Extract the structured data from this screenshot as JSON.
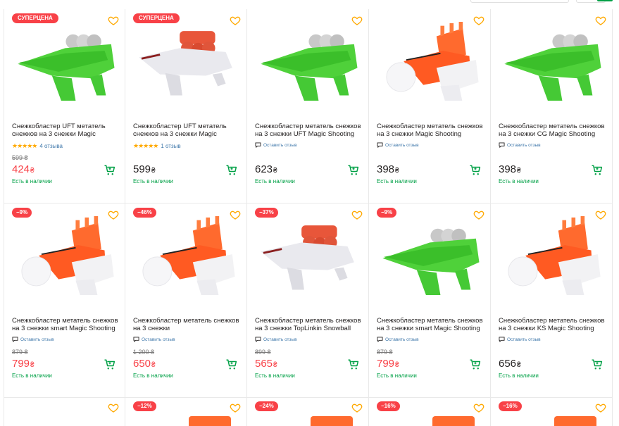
{
  "colors": {
    "accent_green": "#00a046",
    "sale_red": "#f84147",
    "link_blue": "#3e77aa",
    "star": "#ffa900"
  },
  "products": [
    {
      "badge": "СУПЕРЦЕНА",
      "title": "Снежкобластер UFT метатель снежков на 3 снежки Magic",
      "rating_stars": "★★★★★",
      "rating_text": "4 отзыва",
      "review_link": "",
      "old_price": "599 ₴",
      "price": "424",
      "currency": "₴",
      "price_sale": true,
      "stock": "Есть в наличии",
      "image": "green-blaster"
    },
    {
      "badge": "СУПЕРЦЕНА",
      "title": "Снежкобластер UFT метатель снежков на 3 снежки Magic",
      "rating_stars": "★★★★★",
      "rating_text": "1 отзыв",
      "review_link": "",
      "old_price": "",
      "price": "599",
      "currency": "₴",
      "price_sale": false,
      "stock": "Есть в наличии",
      "image": "white-blaster"
    },
    {
      "badge": "",
      "title": "Снежкобластер метатель снежков на 3 снежки UFT Magic Shooting",
      "rating_stars": "",
      "rating_text": "",
      "review_link": "Оставить отзыв",
      "old_price": "",
      "price": "623",
      "currency": "₴",
      "price_sale": false,
      "stock": "Есть в наличии",
      "image": "green-blaster"
    },
    {
      "badge": "",
      "title": "Снежкобластер метатель снежков на 3 снежки Magic Shooting",
      "rating_stars": "",
      "rating_text": "",
      "review_link": "Оставить отзыв",
      "old_price": "",
      "price": "398",
      "currency": "₴",
      "price_sale": false,
      "stock": "Есть в наличии",
      "image": "orange-blaster"
    },
    {
      "badge": "",
      "title": "Снежкобластер метатель снежков на 3 снежки CG Magic Shooting",
      "rating_stars": "",
      "rating_text": "",
      "review_link": "Оставить отзыв",
      "old_price": "",
      "price": "398",
      "currency": "₴",
      "price_sale": false,
      "stock": "Есть в наличии",
      "image": "green-blaster"
    },
    {
      "badge": "−9%",
      "title": "Снежкобластер метатель снежков на 3 снежки smart Magic Shooting",
      "rating_stars": "",
      "rating_text": "",
      "review_link": "Оставить отзыв",
      "old_price": "879 ₴",
      "price": "799",
      "currency": "₴",
      "price_sale": true,
      "stock": "Есть в наличии",
      "image": "orange-blaster"
    },
    {
      "badge": "−46%",
      "title": "Снежкобластер метатель снежков на 3 снежки",
      "rating_stars": "",
      "rating_text": "",
      "review_link": "Оставить отзыв",
      "old_price": "1 200 ₴",
      "price": "650",
      "currency": "₴",
      "price_sale": true,
      "stock": "Есть в наличии",
      "image": "orange-blaster"
    },
    {
      "badge": "−37%",
      "title": "Снежкобластер метатель снежков на 3 снежки TopLinkin Snowball",
      "rating_stars": "",
      "rating_text": "",
      "review_link": "Оставить отзыв",
      "old_price": "899 ₴",
      "price": "565",
      "currency": "₴",
      "price_sale": true,
      "stock": "Есть в наличии",
      "image": "white-blaster"
    },
    {
      "badge": "−9%",
      "title": "Снежкобластер метатель снежков на 3 снежки smart Magic Shooting",
      "rating_stars": "",
      "rating_text": "",
      "review_link": "Оставить отзыв",
      "old_price": "879 ₴",
      "price": "799",
      "currency": "₴",
      "price_sale": true,
      "stock": "Есть в наличии",
      "image": "green-blaster"
    },
    {
      "badge": "",
      "title": "Снежкобластер метатель снежков на 3 снежки KS Magic Shooting",
      "rating_stars": "",
      "rating_text": "",
      "review_link": "Оставить отзыв",
      "old_price": "",
      "price": "656",
      "currency": "₴",
      "price_sale": false,
      "stock": "Есть в наличии",
      "image": "orange-blaster"
    }
  ],
  "row3_badges": [
    "",
    "−12%",
    "−24%",
    "−16%",
    "−16%"
  ]
}
